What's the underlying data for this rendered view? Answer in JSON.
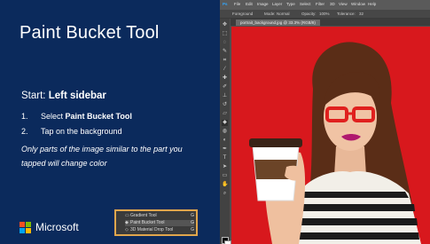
{
  "colors": {
    "panel_bg": "#0b2a5c",
    "canvas_red": "#d8181d",
    "popup_border": "#e0a64d"
  },
  "panel": {
    "title": "Paint Bucket Tool",
    "start_prefix": "Start: ",
    "start_location": "Left sidebar",
    "steps": [
      {
        "num": "1.",
        "prefix": "Select ",
        "bold": "Paint Bucket Tool"
      },
      {
        "num": "2.",
        "text": "Tap on the background"
      }
    ],
    "note": "Only parts of the image similar to the part you tapped will change color",
    "brand": "Microsoft"
  },
  "popup": {
    "items": [
      {
        "icon": "gradient-tool-icon",
        "label": "Gradient Tool",
        "shortcut": "G"
      },
      {
        "icon": "paint-bucket-icon",
        "label": "Paint Bucket Tool",
        "shortcut": "G",
        "selected": true
      },
      {
        "icon": "3d-material-drop-icon",
        "label": "3D Material Drop Tool",
        "shortcut": "G"
      }
    ]
  },
  "photoshop": {
    "menu": [
      "Ps",
      "File",
      "Edit",
      "Image",
      "Layer",
      "Type",
      "Select",
      "Filter",
      "3D",
      "View",
      "Window",
      "Help"
    ],
    "options": [
      "Foreground",
      "Mode:",
      "Normal",
      "Opacity:",
      "100%",
      "Tolerance:",
      "32"
    ],
    "document_tab": "portrait_background.jpg @ 33.3% (RGB/8)"
  }
}
